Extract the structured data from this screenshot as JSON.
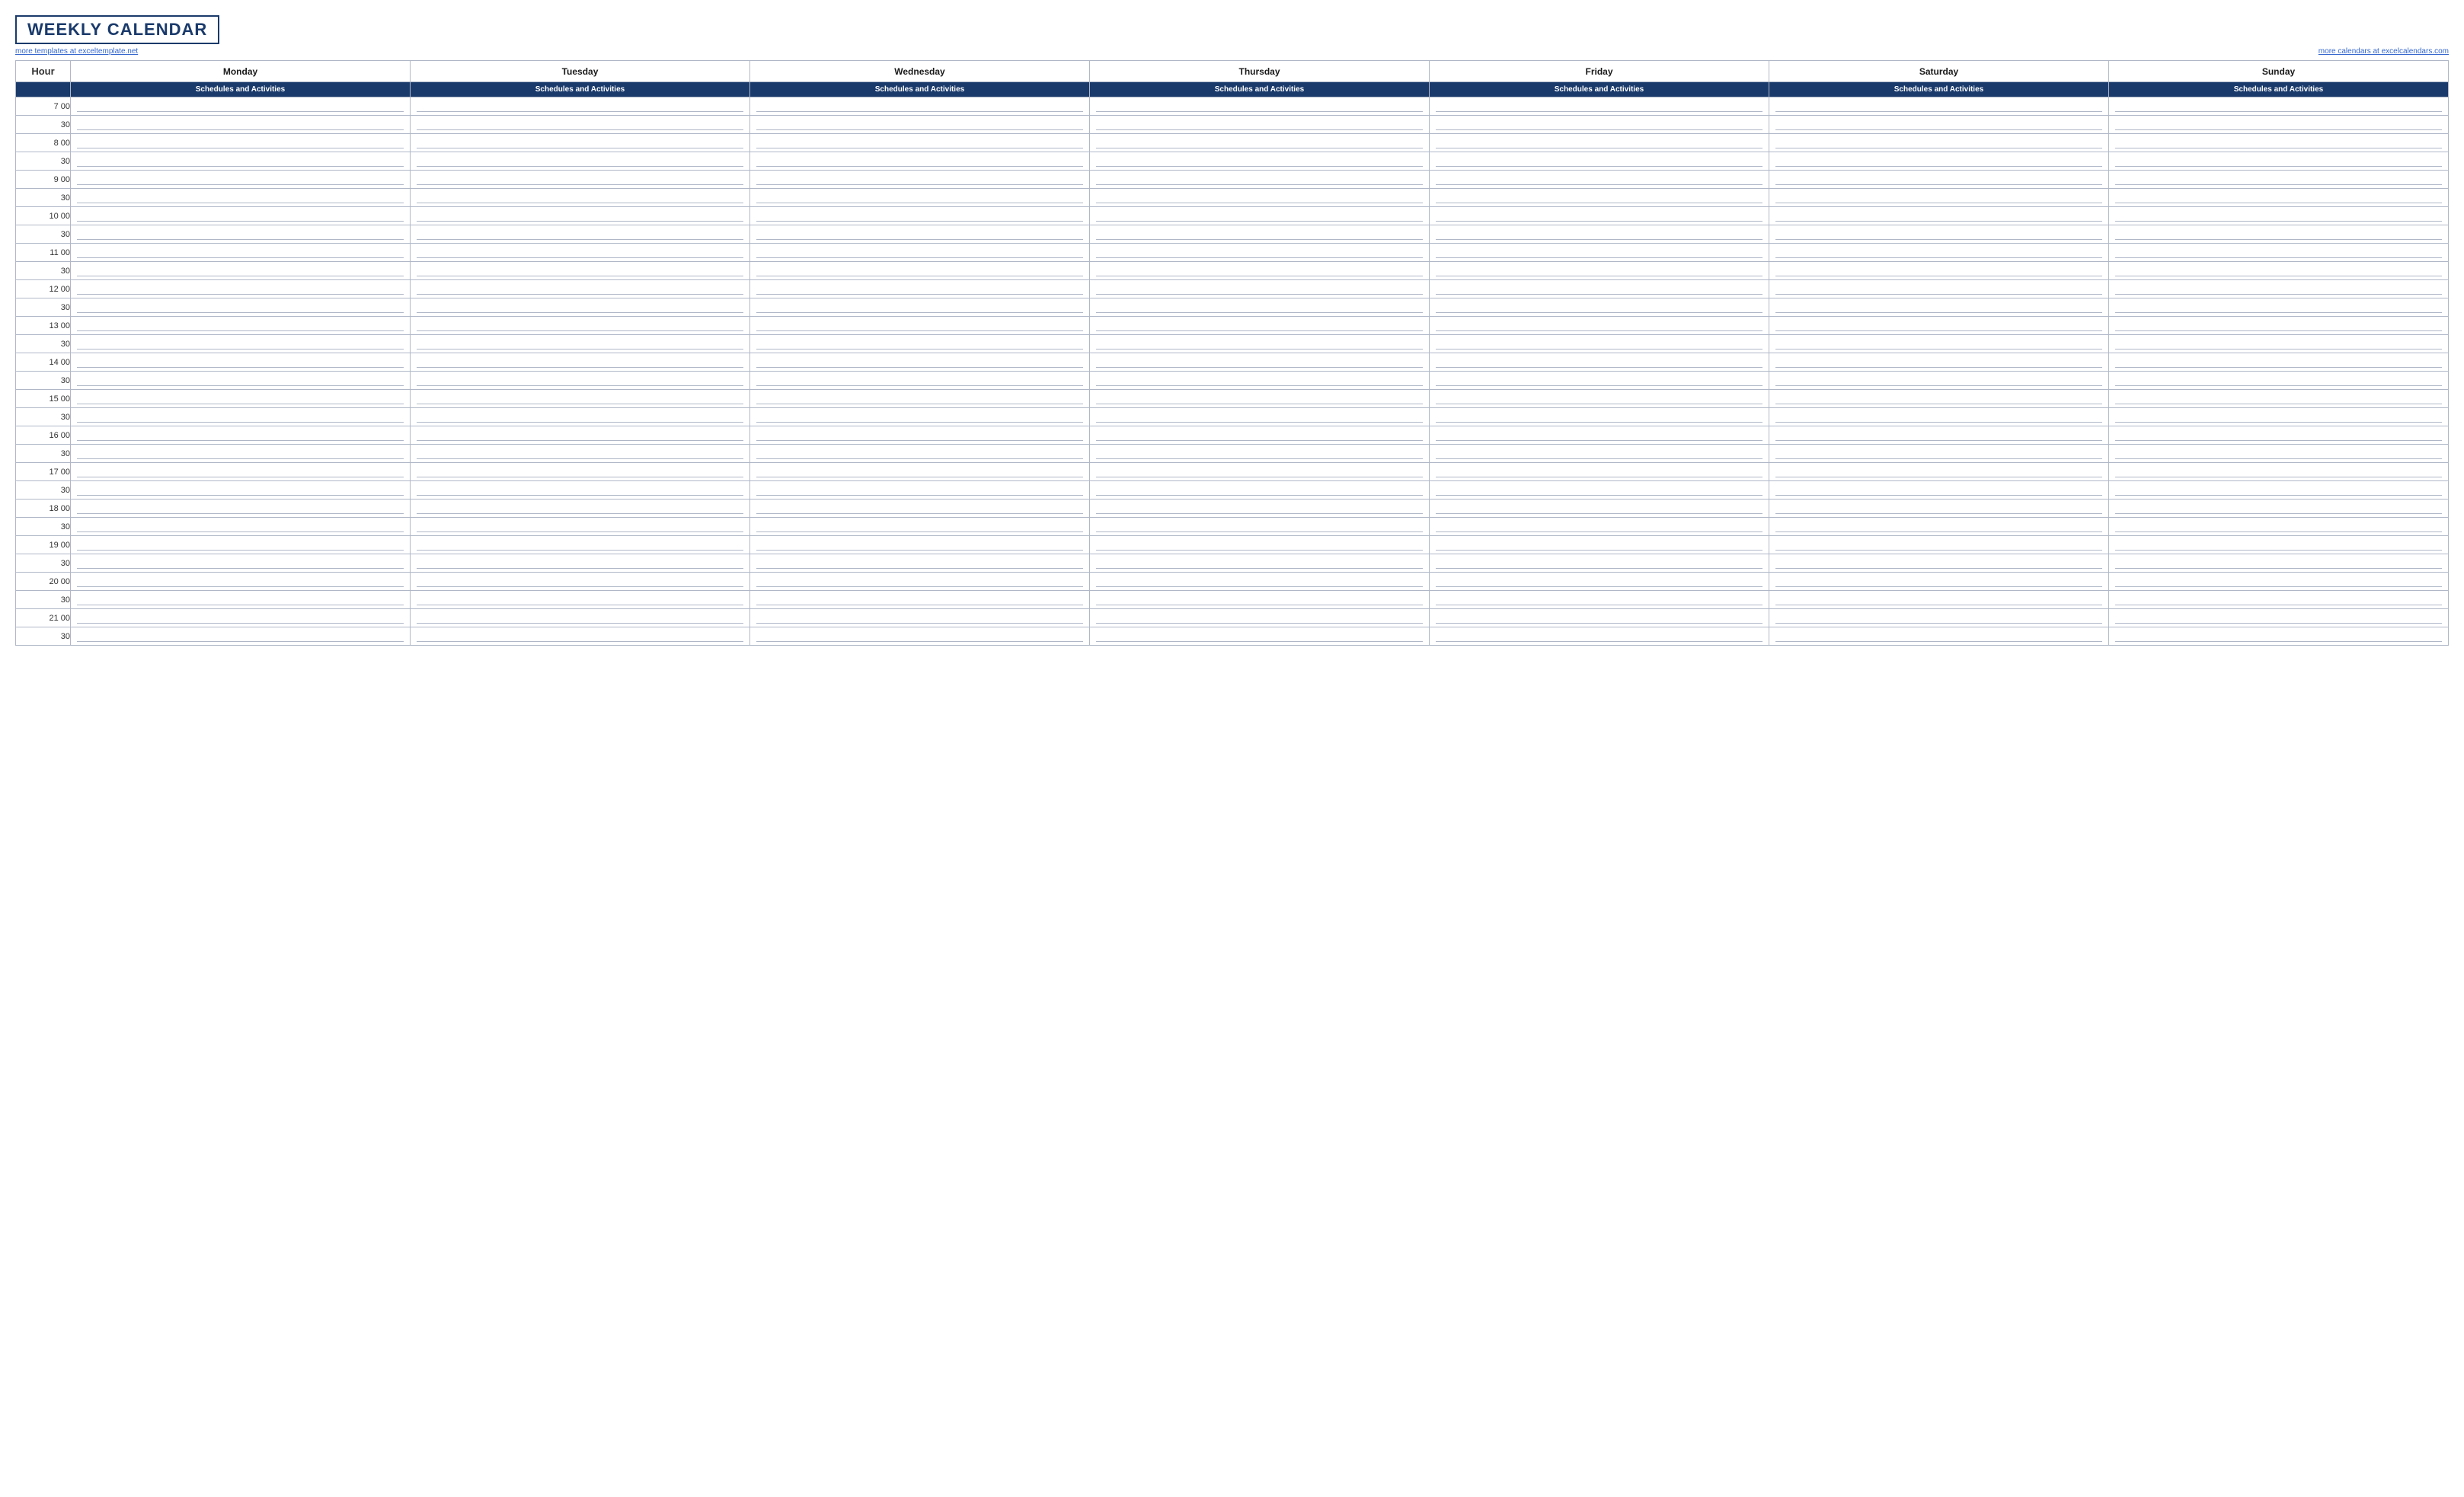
{
  "header": {
    "title": "WEEKLY CALENDAR",
    "link_left": "more templates at exceltemplate.net",
    "link_right": "more calendars at excelcalendars.com"
  },
  "columns": {
    "hour_label": "Hour",
    "days": [
      "Monday",
      "Tuesday",
      "Wednesday",
      "Thursday",
      "Friday",
      "Saturday",
      "Sunday"
    ],
    "subheader": "Schedules and Activities"
  },
  "time_slots": [
    {
      "label": "7  00",
      "type": "hour"
    },
    {
      "label": "30",
      "type": "half"
    },
    {
      "label": "8  00",
      "type": "hour"
    },
    {
      "label": "30",
      "type": "half"
    },
    {
      "label": "9  00",
      "type": "hour"
    },
    {
      "label": "30",
      "type": "half"
    },
    {
      "label": "10  00",
      "type": "hour"
    },
    {
      "label": "30",
      "type": "half"
    },
    {
      "label": "11  00",
      "type": "hour"
    },
    {
      "label": "30",
      "type": "half"
    },
    {
      "label": "12  00",
      "type": "hour"
    },
    {
      "label": "30",
      "type": "half"
    },
    {
      "label": "13  00",
      "type": "hour"
    },
    {
      "label": "30",
      "type": "half"
    },
    {
      "label": "14  00",
      "type": "hour"
    },
    {
      "label": "30",
      "type": "half"
    },
    {
      "label": "15  00",
      "type": "hour"
    },
    {
      "label": "30",
      "type": "half"
    },
    {
      "label": "16  00",
      "type": "hour"
    },
    {
      "label": "30",
      "type": "half"
    },
    {
      "label": "17  00",
      "type": "hour"
    },
    {
      "label": "30",
      "type": "half"
    },
    {
      "label": "18  00",
      "type": "hour"
    },
    {
      "label": "30",
      "type": "half"
    },
    {
      "label": "19  00",
      "type": "hour"
    },
    {
      "label": "30",
      "type": "half"
    },
    {
      "label": "20  00",
      "type": "hour"
    },
    {
      "label": "30",
      "type": "half"
    },
    {
      "label": "21  00",
      "type": "hour"
    },
    {
      "label": "30",
      "type": "half"
    }
  ]
}
